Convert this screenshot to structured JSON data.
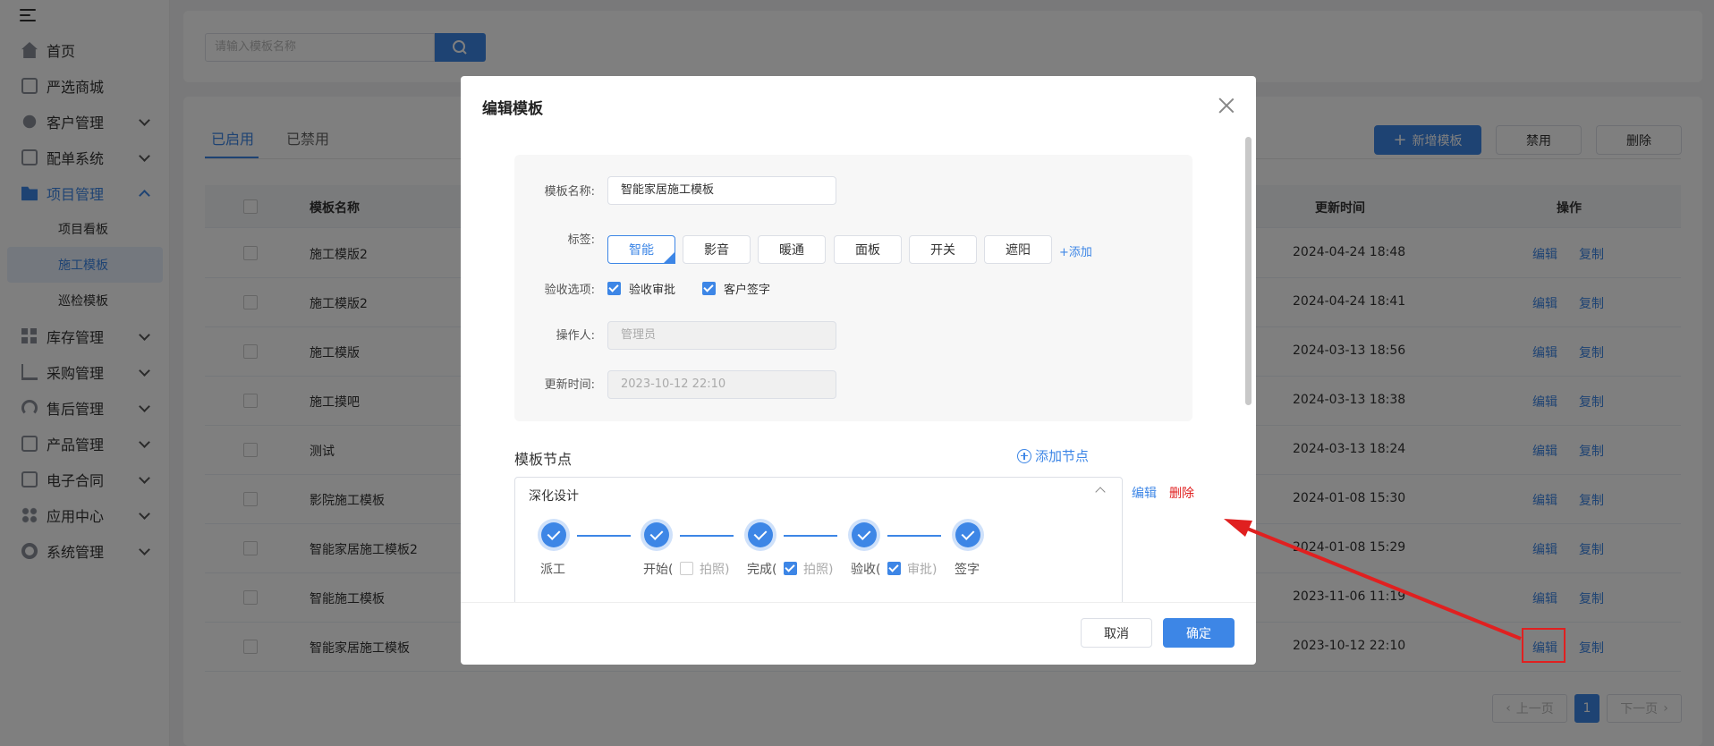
{
  "sidebar": {
    "items": [
      {
        "label": "首页",
        "icon": "home-icon"
      },
      {
        "label": "严选商城",
        "icon": "store-icon"
      },
      {
        "label": "客户管理",
        "icon": "customer-icon"
      },
      {
        "label": "配单系统",
        "icon": "order-icon"
      },
      {
        "label": "项目管理",
        "icon": "folder-icon"
      },
      {
        "label": "库存管理",
        "icon": "inventory-icon"
      },
      {
        "label": "采购管理",
        "icon": "cart-icon"
      },
      {
        "label": "售后管理",
        "icon": "headset-icon"
      },
      {
        "label": "产品管理",
        "icon": "product-icon"
      },
      {
        "label": "电子合同",
        "icon": "contract-icon"
      },
      {
        "label": "应用中心",
        "icon": "apps-icon"
      },
      {
        "label": "系统管理",
        "icon": "settings-icon"
      }
    ],
    "subitems": [
      "项目看板",
      "施工模板",
      "巡检模板"
    ],
    "active_sub": "施工模板"
  },
  "search": {
    "placeholder": "请输入模板名称"
  },
  "tabs": [
    "已启用",
    "已禁用"
  ],
  "toolbar": {
    "add_label": "新增模板",
    "disable_label": "禁用",
    "delete_label": "删除"
  },
  "table": {
    "columns": [
      "模板名称",
      "更新时间",
      "操作"
    ],
    "rows": [
      {
        "name": "施工模版2",
        "time": "2024-04-24 18:48"
      },
      {
        "name": "施工模版2",
        "time": "2024-04-24 18:41"
      },
      {
        "name": "施工模版",
        "time": "2024-03-13 18:56"
      },
      {
        "name": "施工摸吧",
        "time": "2024-03-13 18:38"
      },
      {
        "name": "测试",
        "time": "2024-03-13 18:24"
      },
      {
        "name": "影院施工模板",
        "time": "2024-01-08 15:30"
      },
      {
        "name": "智能家居施工模板2",
        "time": "2024-01-08 15:29"
      },
      {
        "name": "智能施工模板",
        "time": "2023-11-06 11:19"
      },
      {
        "name": "智能家居施工模板",
        "time": "2023-10-12 22:10"
      }
    ],
    "edit_label": "编辑",
    "copy_label": "复制"
  },
  "pagination": {
    "prev": "上一页",
    "current": "1",
    "next": "下一页"
  },
  "dialog": {
    "title": "编辑模板",
    "name_label": "模板名称:",
    "name_value": "智能家居施工模板",
    "tags_label": "标签:",
    "tags": [
      "智能",
      "影音",
      "暖通",
      "面板",
      "开关",
      "遮阳"
    ],
    "add_tag": "+添加",
    "accept_label": "验收选项:",
    "accept_options": [
      "验收审批",
      "客户签字"
    ],
    "operator_label": "操作人:",
    "operator_value": "管理员",
    "update_label": "更新时间:",
    "update_value": "2023-10-12 22:10",
    "nodes_title": "模板节点",
    "add_node": "添加节点",
    "node": {
      "name": "深化设计",
      "edit": "编辑",
      "delete": "删除",
      "steps": [
        "派工",
        "开始(",
        "拍照)",
        "完成(",
        "拍照)",
        "验收(",
        "审批)",
        "签字"
      ]
    },
    "cancel": "取消",
    "confirm": "确定"
  },
  "colors": {
    "accent": "#3d86e6",
    "danger": "#e02020"
  }
}
